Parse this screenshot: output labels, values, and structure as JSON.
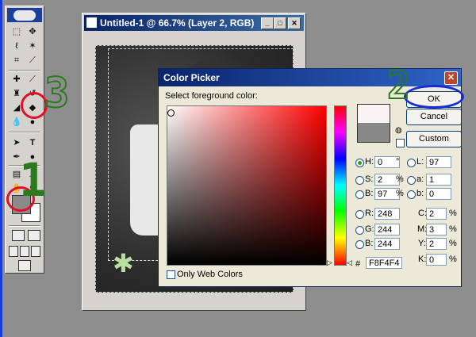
{
  "document": {
    "title": "Untitled-1 @ 66.7% (Layer 2, RGB)"
  },
  "color_picker": {
    "title": "Color Picker",
    "prompt": "Select foreground color:",
    "buttons": {
      "ok": "OK",
      "cancel": "Cancel",
      "custom": "Custom"
    },
    "hsb": {
      "h_label": "H:",
      "h_value": "0",
      "h_unit": "°",
      "s_label": "S:",
      "s_value": "2",
      "s_unit": "%",
      "b_label": "B:",
      "b_value": "97",
      "b_unit": "%"
    },
    "lab": {
      "l_label": "L:",
      "l_value": "97",
      "a_label": "a:",
      "a_value": "1",
      "b_label": "b:",
      "b_value": "0"
    },
    "rgb": {
      "r_label": "R:",
      "r_value": "248",
      "g_label": "G:",
      "g_value": "244",
      "b_label": "B:",
      "b_value": "244"
    },
    "cmyk": {
      "c_label": "C:",
      "c_value": "2",
      "c_unit": "%",
      "m_label": "M:",
      "m_value": "3",
      "m_unit": "%",
      "y_label": "Y:",
      "y_value": "2",
      "y_unit": "%",
      "k_label": "K:",
      "k_value": "0",
      "k_unit": "%"
    },
    "hex_label": "#",
    "hex_value": "F8F4F4",
    "only_web_colors": "Only Web Colors",
    "new_color": "#f8f4f4",
    "old_color": "#888888"
  },
  "annotations": {
    "step1": "1",
    "step2": "2",
    "step3": "3"
  },
  "colors": {
    "foreground_swatch": "#8a8a8a",
    "background_swatch": "#ffffff",
    "annotation_red": "#e0102a",
    "annotation_blue": "#1a2bd6",
    "annotation_green": "#2c7a1e"
  }
}
